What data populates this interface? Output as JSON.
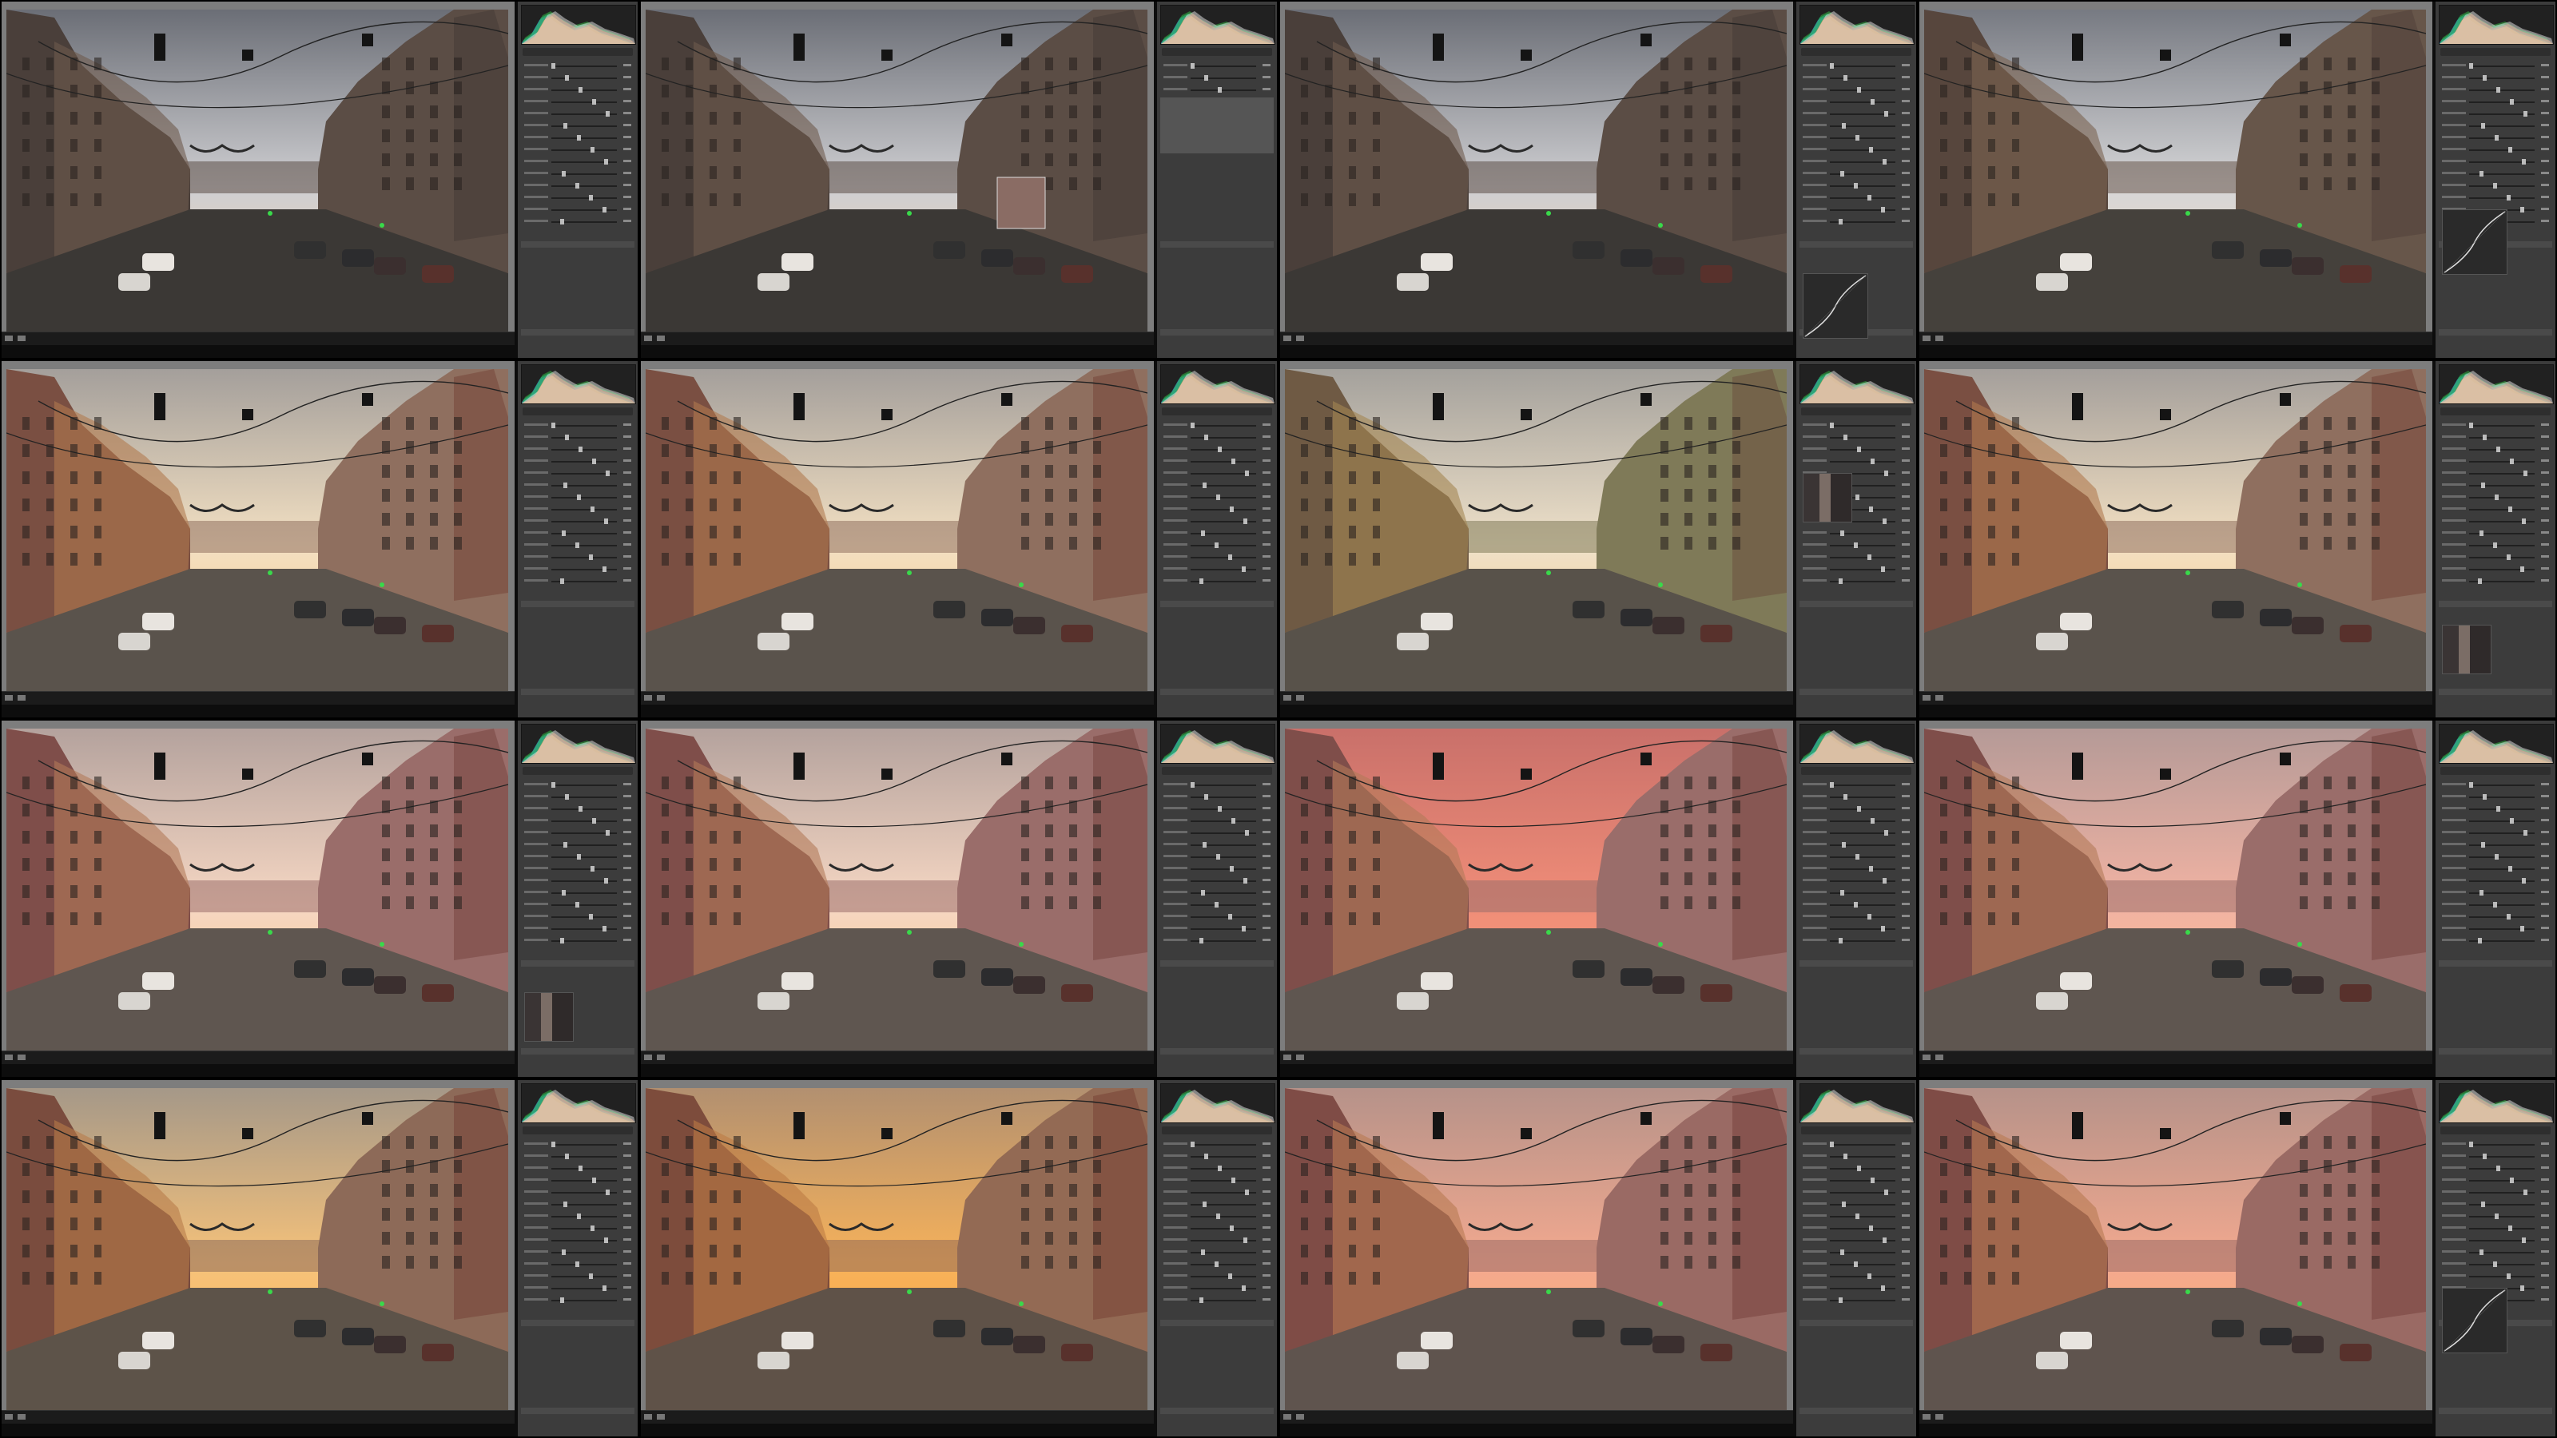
{
  "title": "",
  "cells": [
    {
      "variant": "dull",
      "panel": "basic",
      "overlay": "none"
    },
    {
      "variant": "dull",
      "panel": "dropdown",
      "overlay": "patch"
    },
    {
      "variant": "dull",
      "panel": "curve",
      "overlay": "none"
    },
    {
      "variant": "dull-bright",
      "panel": "curve-large",
      "overlay": "none"
    },
    {
      "variant": "warm",
      "panel": "basic",
      "overlay": "none"
    },
    {
      "variant": "warm",
      "panel": "basic",
      "overlay": "none"
    },
    {
      "variant": "warm-green",
      "panel": "swatch",
      "overlay": "none"
    },
    {
      "variant": "warm",
      "panel": "swatch-low",
      "overlay": "none"
    },
    {
      "variant": "warm-pink",
      "panel": "swatch-bottom",
      "overlay": "none"
    },
    {
      "variant": "warm-pink",
      "panel": "basic",
      "overlay": "none"
    },
    {
      "variant": "red-sky",
      "panel": "basic",
      "overlay": "none"
    },
    {
      "variant": "pink-sky",
      "panel": "basic",
      "overlay": "none"
    },
    {
      "variant": "golden",
      "panel": "basic",
      "overlay": "none"
    },
    {
      "variant": "golden-strong",
      "panel": "basic",
      "overlay": "none"
    },
    {
      "variant": "pink-sunset",
      "panel": "basic",
      "overlay": "none"
    },
    {
      "variant": "pink-sunset",
      "panel": "curve-large",
      "overlay": "none"
    }
  ],
  "palette": {
    "dull": {
      "sky1": "#cfcfd2",
      "sky2": "#6b6e76",
      "glow": "#f1cfa8",
      "bldA": "#4a3f3a",
      "bldB": "#6e5a4c",
      "bldC": "#5b4d45",
      "street": "#3b3835"
    },
    "dull-bright": {
      "sky1": "#d6d6d8",
      "sky2": "#777a82",
      "glow": "#f3d6b2",
      "bldA": "#57463d",
      "bldB": "#7a6350",
      "bldC": "#67564a",
      "street": "#45413c"
    },
    "warm": {
      "sky1": "#f3e0c2",
      "sky2": "#a49f9b",
      "glow": "#f8c47c",
      "bldA": "#7a4f42",
      "bldB": "#b07a4e",
      "bldC": "#8f6f5f",
      "street": "#5a534c"
    },
    "warm-green": {
      "sky1": "#efe1c9",
      "sky2": "#a4a19c",
      "glow": "#f6c67e",
      "bldA": "#6f5a44",
      "bldB": "#a48552",
      "bldC": "#7f7a58",
      "street": "#58524a"
    },
    "warm-pink": {
      "sky1": "#f6d7c3",
      "sky2": "#b4a29d",
      "glow": "#f8c07c",
      "bldA": "#7f4e4a",
      "bldB": "#b27a58",
      "bldC": "#9a6d6a",
      "street": "#5f5650"
    },
    "red-sky": {
      "sky1": "#f08d78",
      "sky2": "#c9706a",
      "glow": "#f9a57a",
      "bldA": "#7f4e4a",
      "bldB": "#b27a58",
      "bldC": "#9a6d6a",
      "street": "#5f5650"
    },
    "pink-sky": {
      "sky1": "#f2b3a3",
      "sky2": "#b59a97",
      "glow": "#f8b985",
      "bldA": "#7f4e4a",
      "bldB": "#b27a58",
      "bldC": "#9a6d6a",
      "street": "#5f5650"
    },
    "golden": {
      "sky1": "#f6c27a",
      "sky2": "#a59888",
      "glow": "#ffb34e",
      "bldA": "#7a4c3e",
      "bldB": "#b77c4a",
      "bldC": "#8d6a58",
      "street": "#5d5349"
    },
    "golden-strong": {
      "sky1": "#f7b25a",
      "sky2": "#b29070",
      "glow": "#ffa23a",
      "bldA": "#7d4c3c",
      "bldB": "#bd7c45",
      "bldC": "#936a54",
      "street": "#5f5248"
    },
    "pink-sunset": {
      "sky1": "#f3a98f",
      "sky2": "#b69289",
      "glow": "#ffae62",
      "bldA": "#7f4c46",
      "bldB": "#b87a52",
      "bldC": "#9a6a64",
      "street": "#5f544e"
    }
  }
}
